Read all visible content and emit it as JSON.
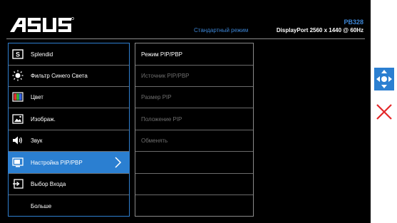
{
  "header": {
    "model": "PB328",
    "mode": "Стандартный режим",
    "input_info": "DisplayPort 2560 x 1440 @ 60Hz"
  },
  "menu": [
    {
      "label": "Splendid",
      "icon": "splendid-icon",
      "active": false
    },
    {
      "label": "Фильтр Синего Света",
      "icon": "blue-light-filter-icon",
      "active": false
    },
    {
      "label": "Цвет",
      "icon": "color-icon",
      "active": false
    },
    {
      "label": "Изображ.",
      "icon": "image-icon",
      "active": false
    },
    {
      "label": "Звук",
      "icon": "sound-icon",
      "active": false
    },
    {
      "label": "Настройка PIP/PBP",
      "icon": "pip-pbp-icon",
      "active": true
    },
    {
      "label": "Выбор Входа",
      "icon": "input-select-icon",
      "active": false
    },
    {
      "label": "Больше",
      "icon": "",
      "active": false
    }
  ],
  "submenu": [
    {
      "label": "Режим PIP/PBP",
      "enabled": true
    },
    {
      "label": "Источник PIP/PBP",
      "enabled": false
    },
    {
      "label": "Размер PIP",
      "enabled": false
    },
    {
      "label": "Положение PIP",
      "enabled": false
    },
    {
      "label": "Обменять",
      "enabled": false
    },
    {
      "label": "",
      "enabled": false
    },
    {
      "label": "",
      "enabled": false
    },
    {
      "label": "",
      "enabled": false
    }
  ],
  "colors": {
    "accent": "#2b7fd1",
    "close": "#e3282a",
    "background": "#000000"
  }
}
